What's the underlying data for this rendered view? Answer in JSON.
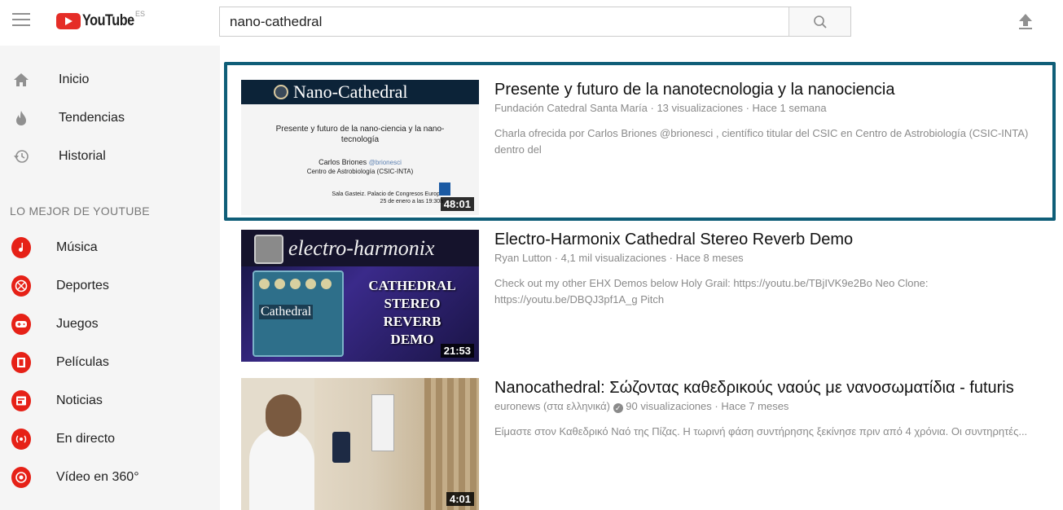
{
  "header": {
    "logo_text": "YouTube",
    "logo_country": "ES",
    "search_value": "nano-cathedral"
  },
  "sidebar": {
    "items": [
      {
        "label": "Inicio",
        "icon": "home-icon"
      },
      {
        "label": "Tendencias",
        "icon": "flame-icon"
      },
      {
        "label": "Historial",
        "icon": "history-icon"
      }
    ],
    "section_title": "LO MEJOR DE YOUTUBE",
    "best_items": [
      {
        "label": "Música",
        "icon": "music-icon"
      },
      {
        "label": "Deportes",
        "icon": "sports-icon"
      },
      {
        "label": "Juegos",
        "icon": "gamepad-icon"
      },
      {
        "label": "Películas",
        "icon": "film-icon"
      },
      {
        "label": "Noticias",
        "icon": "news-icon"
      },
      {
        "label": "En directo",
        "icon": "live-icon"
      },
      {
        "label": "Vídeo en 360°",
        "icon": "360-icon"
      }
    ]
  },
  "results": [
    {
      "title": "Presente y futuro de la nanotecnologia y la nanociencia",
      "channel": "Fundación Catedral Santa María",
      "views": "13 visualizaciones",
      "age": "Hace 1 semana",
      "description": "Charla ofrecida por Carlos Briones @brionesci , científico titular del CSIC en Centro de Astrobiología (CSIC-INTA) dentro del",
      "duration": "48:01",
      "thumb": {
        "heading": "Nano-Cathedral",
        "line1": "Presente y futuro de la nano-ciencia y la nano-tecnología",
        "speaker": "Carlos Briones",
        "handle": "@brionesci",
        "affiliation": "Centro de Astrobiología (CSIC-INTA)",
        "venue": "Sala Gasteiz. Palacio de Congresos Europa",
        "date": "25 de enero a las 19:30h"
      }
    },
    {
      "title": "Electro-Harmonix Cathedral Stereo Reverb Demo",
      "channel": "Ryan Lutton",
      "views": "4,1 mil visualizaciones",
      "age": "Hace 8 meses",
      "description": "Check out my other EHX Demos below Holy Grail: https://youtu.be/TBjIVK9e2Bo Neo Clone: https://youtu.be/DBQJ3pf1A_g Pitch",
      "duration": "21:53",
      "thumb": {
        "brand": "electro-harmonix",
        "pedal_name": "Cathedral",
        "words": [
          "CATHEDRAL",
          "STEREO",
          "REVERB",
          "DEMO"
        ]
      }
    },
    {
      "title": "Nanocathedral: Σώζοντας καθεδρικούς ναούς με νανοσωματίδια - futuris",
      "channel": "euronews (στα ελληνικά)",
      "views": "90 visualizaciones",
      "age": "Hace 7 meses",
      "description": "Είμαστε στον Καθεδρικό Ναό της Πίζας. Η τωρινή φάση συντήρησης ξεκίνησε πριν από 4 χρόνια. Οι συντηρητές...",
      "duration": "4:01"
    }
  ],
  "colors": {
    "brand_red": "#e52d27",
    "highlight_border": "#0f5e78",
    "sidebar_bg": "#f5f5f5"
  }
}
